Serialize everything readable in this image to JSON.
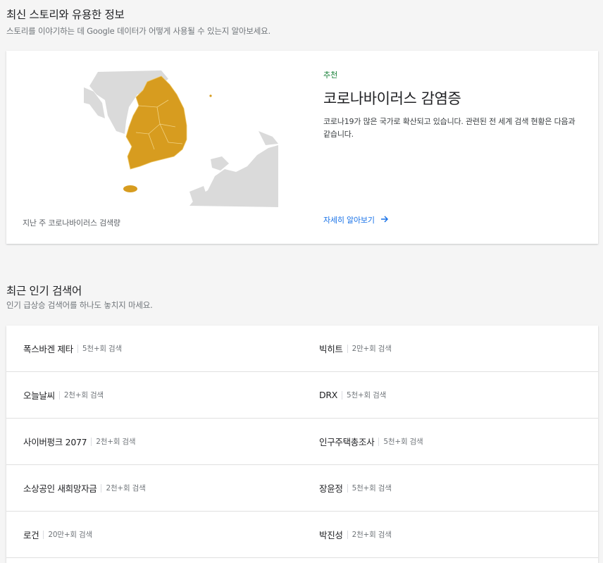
{
  "stories": {
    "title": "최신 스토리와 유용한 정보",
    "subtitle": "스토리를 이야기하는 데 Google 데이터가 어떻게 사용될 수 있는지 알아보세요.",
    "card": {
      "tag": "추천",
      "title": "코로나바이러스 감염증",
      "description": "코로나19가 많은 국가로 확산되고 있습니다. 관련된 전 세계 검색 현황은 다음과 같습니다.",
      "link": "자세히 알아보기",
      "map_caption": "지난 주 코로나바이러스 검색량",
      "map_color": "#d79c1f",
      "land_color": "#dadada"
    }
  },
  "trending": {
    "title": "최근 인기 검색어",
    "subtitle": "인기 급상승 검색어를 하나도 놓치지 마세요.",
    "rows": [
      {
        "left": {
          "term": "폭스바겐 제타",
          "count": "5천+회 검색"
        },
        "right": {
          "term": "빅히트",
          "count": "2만+회 검색"
        }
      },
      {
        "left": {
          "term": "오늘날씨",
          "count": "2천+회 검색"
        },
        "right": {
          "term": "DRX",
          "count": "5천+회 검색"
        }
      },
      {
        "left": {
          "term": "사이버펑크 2077",
          "count": "2천+회 검색"
        },
        "right": {
          "term": "인구주택총조사",
          "count": "5천+회 검색"
        }
      },
      {
        "left": {
          "term": "소상공인 새희망자금",
          "count": "2천+회 검색"
        },
        "right": {
          "term": "장윤정",
          "count": "5천+회 검색"
        }
      },
      {
        "left": {
          "term": "로건",
          "count": "20만+회 검색"
        },
        "right": {
          "term": "박진성",
          "count": "2천+회 검색"
        }
      }
    ]
  }
}
